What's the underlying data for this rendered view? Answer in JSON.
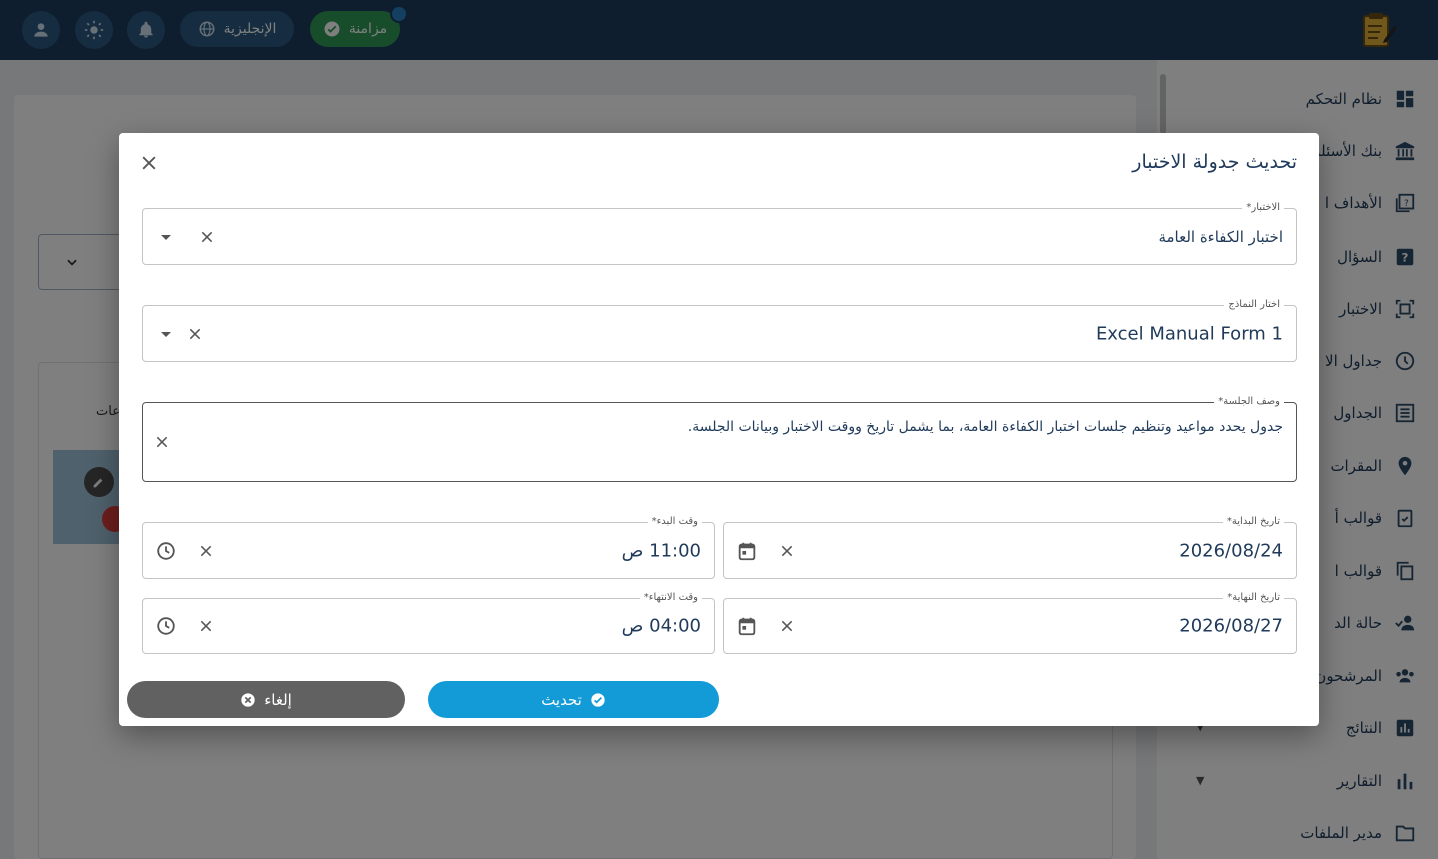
{
  "topbar": {
    "language_label": "الإنجليزية",
    "sync_label": "مزامنة"
  },
  "sidebar": {
    "items": [
      {
        "label": "نظام التحكم",
        "icon": "dashboard-icon"
      },
      {
        "label": "بنك الأسئلة",
        "icon": "bank-icon"
      },
      {
        "label": "الأهداف ا",
        "icon": "objectives-icon"
      },
      {
        "label": "السؤال",
        "icon": "question-icon"
      },
      {
        "label": "الاختبار",
        "icon": "exam-icon"
      },
      {
        "label": "جداول الا",
        "icon": "clock-icon"
      },
      {
        "label": "الجداول",
        "icon": "list-icon"
      },
      {
        "label": "المقرات",
        "icon": "location-icon"
      },
      {
        "label": "قوالب أ",
        "icon": "clipboard-icon"
      },
      {
        "label": "قوالب ا",
        "icon": "copy-icon"
      },
      {
        "label": "حالة الد",
        "icon": "user-status-icon"
      },
      {
        "label": "المرشحون",
        "icon": "group-icon"
      },
      {
        "label": "النتائج",
        "icon": "results-icon"
      },
      {
        "label": "التقارير",
        "icon": "bar-chart-icon"
      },
      {
        "label": "مدير الملفات",
        "icon": "folder-icon"
      }
    ]
  },
  "background": {
    "tile_label": "عات"
  },
  "modal": {
    "title": "تحديث جدولة الاختبار",
    "exam": {
      "label": "الاختبار*",
      "value": "اختبار الكفاءة العامة"
    },
    "form": {
      "label": "اختار النماذج",
      "value": "Excel Manual Form 1"
    },
    "description": {
      "label": "وصف الجلسة*",
      "value": "جدول يحدد مواعيد وتنظيم جلسات اختبار الكفاءة العامة، بما يشمل تاريخ ووقت الاختبار وبيانات الجلسة."
    },
    "start_date": {
      "label": "تاريخ البداية*",
      "value": "2026/08/24"
    },
    "start_time": {
      "label": "وقت البدء*",
      "value": "11:00 ص"
    },
    "end_date": {
      "label": "تاريخ النهاية*",
      "value": "2026/08/27"
    },
    "end_time": {
      "label": "وقت الانتهاء*",
      "value": "04:00 ص"
    },
    "update_label": "تحديث",
    "cancel_label": "إلغاء"
  },
  "colors": {
    "topbar": "#1d3d5f",
    "primary": "#139bd7",
    "sync": "#2e9a55",
    "cancel": "#616161"
  }
}
